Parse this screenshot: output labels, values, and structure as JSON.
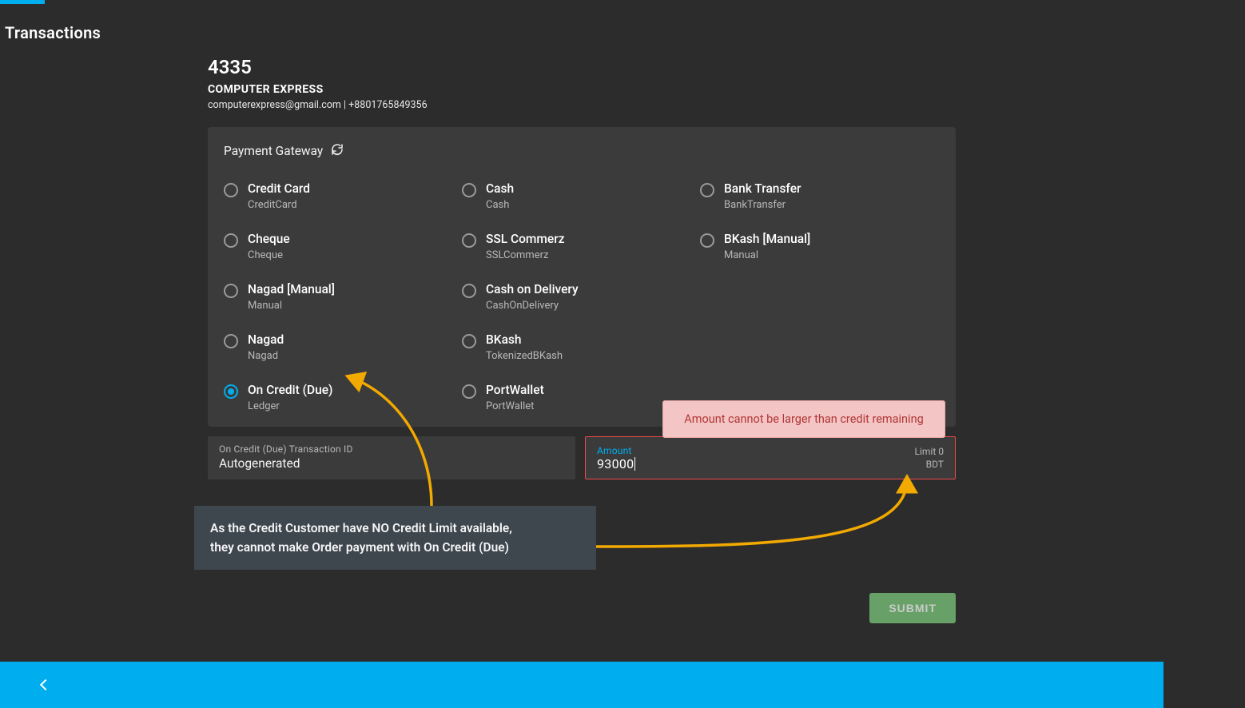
{
  "page_title": "Transactions",
  "customer": {
    "id": "4335",
    "name": "COMPUTER EXPRESS",
    "email": "computerexpress@gmail.com",
    "phone": "+8801765849356"
  },
  "panel": {
    "title": "Payment Gateway"
  },
  "payment_options": {
    "col1": [
      {
        "label": "Credit Card",
        "sub": "CreditCard",
        "selected": false
      },
      {
        "label": "Cheque",
        "sub": "Cheque",
        "selected": false
      },
      {
        "label": "Nagad [Manual]",
        "sub": "Manual",
        "selected": false
      },
      {
        "label": "Nagad",
        "sub": "Nagad",
        "selected": false
      },
      {
        "label": "On Credit (Due)",
        "sub": "Ledger",
        "selected": true
      }
    ],
    "col2": [
      {
        "label": "Cash",
        "sub": "Cash",
        "selected": false
      },
      {
        "label": "SSL Commerz",
        "sub": "SSLCommerz",
        "selected": false
      },
      {
        "label": "Cash on Delivery",
        "sub": "CashOnDelivery",
        "selected": false
      },
      {
        "label": "BKash",
        "sub": "TokenizedBKash",
        "selected": false
      },
      {
        "label": "PortWallet",
        "sub": "PortWallet",
        "selected": false
      }
    ],
    "col3": [
      {
        "label": "Bank Transfer",
        "sub": "BankTransfer",
        "selected": false
      },
      {
        "label": "BKash [Manual]",
        "sub": "Manual",
        "selected": false
      }
    ]
  },
  "fields": {
    "txid": {
      "label": "On Credit (Due) Transaction ID",
      "value": "Autogenerated"
    },
    "amount": {
      "label": "Amount",
      "value": "93000",
      "limit_label": "Limit 0",
      "currency": "BDT",
      "error": "Amount cannot be larger than credit remaining"
    }
  },
  "submit_label": "SUBMIT",
  "annotation": {
    "line1": "As the Credit Customer have NO Credit Limit available,",
    "line2": "they cannot make Order payment with On Credit (Due)"
  },
  "colors": {
    "accent": "#00aeef",
    "arrow": "#f2a900",
    "error_border": "#f04a4a",
    "submit": "#7bc97b"
  }
}
